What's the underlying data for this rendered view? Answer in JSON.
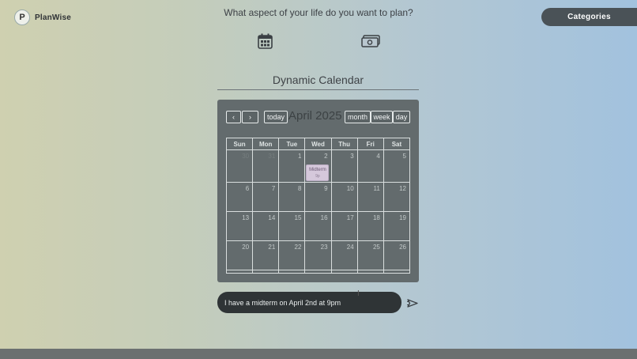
{
  "app": {
    "name": "PlanWise",
    "logo_glyph": "P"
  },
  "header": {
    "question": "What aspect of your life do you want to plan?",
    "categories_label": "Categories",
    "icons": [
      "calendar-icon",
      "money-icon"
    ]
  },
  "calendar": {
    "title": "Dynamic Calendar",
    "month_label": "April 2025",
    "buttons": {
      "prev": "‹",
      "next": "›",
      "today": "today",
      "month": "month",
      "week": "week",
      "day": "day"
    },
    "weekdays": [
      "Sun",
      "Mon",
      "Tue",
      "Wed",
      "Thu",
      "Fri",
      "Sat"
    ],
    "weeks": [
      [
        "30",
        "31",
        "1",
        "2",
        "3",
        "4",
        "5"
      ],
      [
        "6",
        "7",
        "8",
        "9",
        "10",
        "11",
        "12"
      ],
      [
        "13",
        "14",
        "15",
        "16",
        "17",
        "18",
        "19"
      ],
      [
        "20",
        "21",
        "22",
        "23",
        "24",
        "25",
        "26"
      ]
    ],
    "event": {
      "title": "Midterm",
      "time": "9p",
      "day": "2"
    }
  },
  "chat": {
    "input_value": "I have a midterm on April 2nd at 9pm",
    "send_icon": "send-icon"
  },
  "colors": {
    "panel": "#636b6d",
    "category_button": "#4a5257",
    "chat_input": "#2f3436",
    "event": "#d5c8db"
  }
}
